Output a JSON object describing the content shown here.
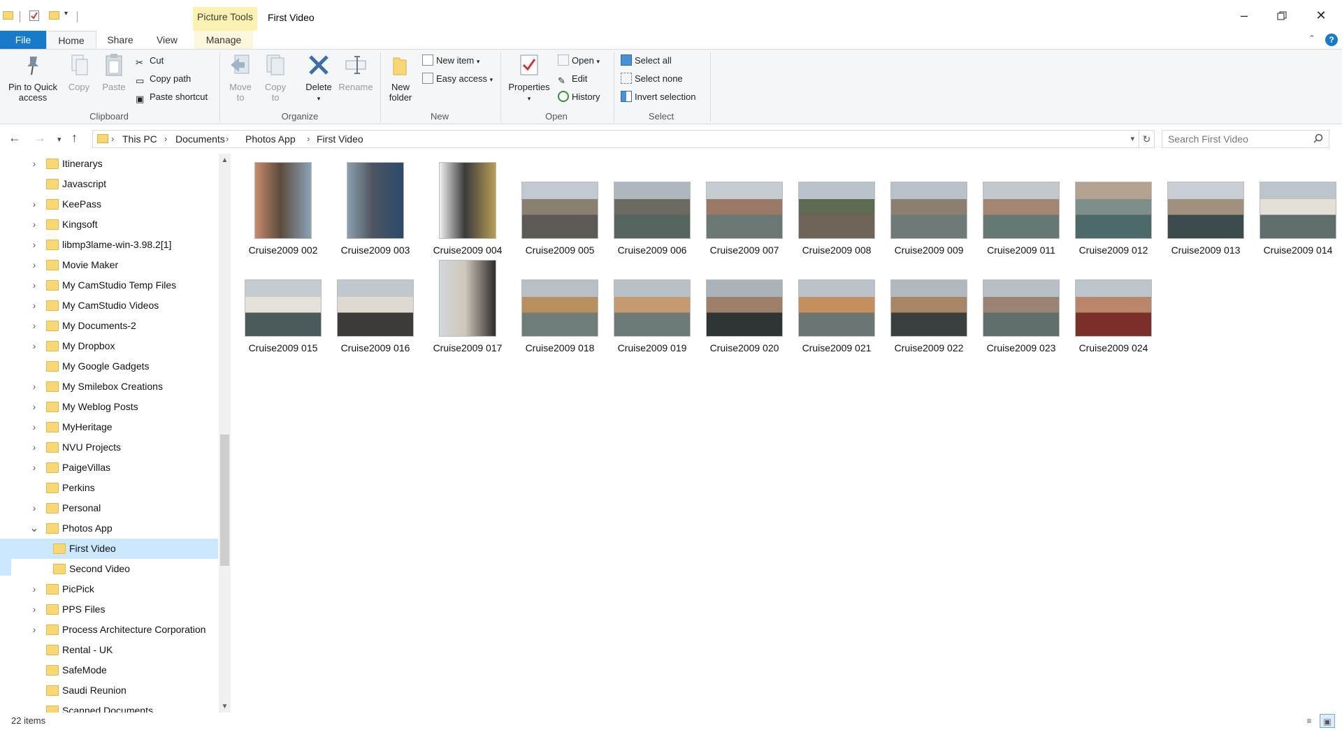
{
  "window": {
    "title": "First Video",
    "contextual_tab": "Picture Tools",
    "minimize_icon": "minimize-icon",
    "restore_icon": "restore-icon",
    "close_icon": "close-icon"
  },
  "tabs": {
    "file": "File",
    "home": "Home",
    "share": "Share",
    "view": "View",
    "manage": "Manage"
  },
  "ribbon": {
    "clipboard": {
      "label": "Clipboard",
      "pin": "Pin to Quick access",
      "copy": "Copy",
      "paste": "Paste",
      "cut": "Cut",
      "copy_path": "Copy path",
      "paste_shortcut": "Paste shortcut"
    },
    "organize": {
      "label": "Organize",
      "move_to": "Move to",
      "copy_to": "Copy to",
      "delete": "Delete",
      "rename": "Rename"
    },
    "new": {
      "label": "New",
      "new_folder": "New folder",
      "new_item": "New item",
      "easy_access": "Easy access"
    },
    "open": {
      "label": "Open",
      "properties": "Properties",
      "open": "Open",
      "edit": "Edit",
      "history": "History"
    },
    "select": {
      "label": "Select",
      "select_all": "Select all",
      "select_none": "Select none",
      "invert_selection": "Invert selection"
    }
  },
  "address": {
    "crumbs": [
      "This PC",
      "Documents",
      "Photos App",
      "First Video"
    ],
    "search_placeholder": "Search First Video"
  },
  "tree": [
    {
      "label": "Itinerarys",
      "expandable": true
    },
    {
      "label": "Javascript",
      "expandable": false
    },
    {
      "label": "KeePass",
      "expandable": true
    },
    {
      "label": "Kingsoft",
      "expandable": true
    },
    {
      "label": "libmp3lame-win-3.98.2[1]",
      "expandable": true
    },
    {
      "label": "Movie Maker",
      "expandable": true
    },
    {
      "label": "My CamStudio Temp Files",
      "expandable": true
    },
    {
      "label": "My CamStudio Videos",
      "expandable": true
    },
    {
      "label": "My Documents-2",
      "expandable": true
    },
    {
      "label": "My Dropbox",
      "expandable": true
    },
    {
      "label": "My Google Gadgets",
      "expandable": false
    },
    {
      "label": "My Smilebox Creations",
      "expandable": true
    },
    {
      "label": "My Weblog Posts",
      "expandable": true
    },
    {
      "label": "MyHeritage",
      "expandable": true
    },
    {
      "label": "NVU Projects",
      "expandable": true
    },
    {
      "label": "PaigeVillas",
      "expandable": true
    },
    {
      "label": "Perkins",
      "expandable": false
    },
    {
      "label": "Personal",
      "expandable": true
    },
    {
      "label": "Photos App",
      "expandable": true,
      "expanded": true
    },
    {
      "label": "First Video",
      "child": true,
      "selected": true
    },
    {
      "label": "Second Video",
      "child": true
    },
    {
      "label": "PicPick",
      "expandable": true
    },
    {
      "label": "PPS Files",
      "expandable": true
    },
    {
      "label": "Process Architecture Corporation",
      "expandable": true
    },
    {
      "label": "Rental - UK",
      "expandable": false
    },
    {
      "label": "SafeMode",
      "expandable": false
    },
    {
      "label": "Saudi Reunion",
      "expandable": false
    },
    {
      "label": "Scanned Documents",
      "expandable": false
    }
  ],
  "files": [
    {
      "name": "Cruise2009 002",
      "orient": "portrait",
      "colors": [
        "#c98a6e",
        "#5c4b3d",
        "#8aa3b5"
      ]
    },
    {
      "name": "Cruise2009 003",
      "orient": "portrait",
      "colors": [
        "#8c9faf",
        "#4d5560",
        "#2b4a6b"
      ]
    },
    {
      "name": "Cruise2009 004",
      "orient": "portrait",
      "colors": [
        "#efefef",
        "#3a3a3a",
        "#b99d55"
      ]
    },
    {
      "name": "Cruise2009 005",
      "orient": "landscape",
      "colors": [
        "#c2c9d1",
        "#8a8070",
        "#5b5a55"
      ]
    },
    {
      "name": "Cruise2009 006",
      "orient": "landscape",
      "colors": [
        "#aeb7be",
        "#6b6a5e",
        "#56655f"
      ]
    },
    {
      "name": "Cruise2009 007",
      "orient": "landscape",
      "colors": [
        "#c6cdd2",
        "#9a7a66",
        "#6a7772"
      ]
    },
    {
      "name": "Cruise2009 008",
      "orient": "landscape",
      "colors": [
        "#b9c3cc",
        "#5e6a52",
        "#6e6458"
      ]
    },
    {
      "name": "Cruise2009 009",
      "orient": "landscape",
      "colors": [
        "#b8c2ca",
        "#8c7e70",
        "#6d7a78"
      ]
    },
    {
      "name": "Cruise2009 011",
      "orient": "landscape",
      "colors": [
        "#c1c8ce",
        "#a38672",
        "#667873"
      ]
    },
    {
      "name": "Cruise2009 012",
      "orient": "landscape",
      "colors": [
        "#b4a290",
        "#7e8f8b",
        "#4d6a6a"
      ]
    },
    {
      "name": "Cruise2009 013",
      "orient": "landscape",
      "colors": [
        "#c8ced3",
        "#a0917f",
        "#3b4a4a"
      ]
    },
    {
      "name": "Cruise2009 014",
      "orient": "landscape",
      "colors": [
        "#bcc5cc",
        "#e4e0d8",
        "#5f6e6c"
      ]
    },
    {
      "name": "Cruise2009 015",
      "orient": "landscape",
      "colors": [
        "#c4ccd3",
        "#e6e2da",
        "#4a5a5a"
      ]
    },
    {
      "name": "Cruise2009 016",
      "orient": "landscape",
      "colors": [
        "#c0c8cf",
        "#dedad2",
        "#3e3a38"
      ]
    },
    {
      "name": "Cruise2009 017",
      "orient": "portrait",
      "colors": [
        "#d1d7dc",
        "#cfc8bb",
        "#2f2b29"
      ]
    },
    {
      "name": "Cruise2009 018",
      "orient": "landscape",
      "colors": [
        "#b7c0c7",
        "#b89060",
        "#6e7d79"
      ]
    },
    {
      "name": "Cruise2009 019",
      "orient": "landscape",
      "colors": [
        "#b8c1c8",
        "#c69a70",
        "#6c7b77"
      ]
    },
    {
      "name": "Cruise2009 020",
      "orient": "landscape",
      "colors": [
        "#aab3ba",
        "#9e7f6a",
        "#2f3436"
      ]
    },
    {
      "name": "Cruise2009 021",
      "orient": "landscape",
      "colors": [
        "#bac3ca",
        "#c48f5d",
        "#6a7673"
      ]
    },
    {
      "name": "Cruise2009 022",
      "orient": "landscape",
      "colors": [
        "#b0b9c0",
        "#a98567",
        "#3a4040"
      ]
    },
    {
      "name": "Cruise2009 023",
      "orient": "landscape",
      "colors": [
        "#b6bfc6",
        "#9a8373",
        "#5f6e6b"
      ]
    },
    {
      "name": "Cruise2009 024",
      "orient": "landscape",
      "colors": [
        "#bdc5cc",
        "#b9866a",
        "#7a2f2a"
      ]
    }
  ],
  "status": {
    "count": "22 items"
  },
  "colors": {
    "accent": "#1979ca",
    "selected_bg": "#cce8ff",
    "folder": "#f8d775",
    "picture_tools": "#fbf1b0"
  }
}
